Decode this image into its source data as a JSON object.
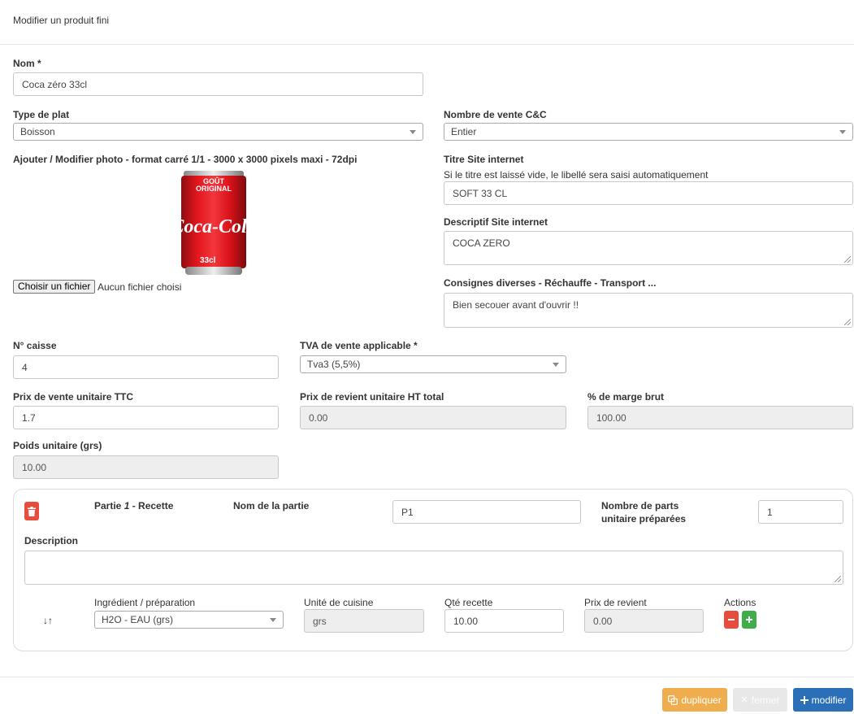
{
  "page": {
    "title": "Modifier un produit fini"
  },
  "form": {
    "nom": {
      "label": "Nom *",
      "value": "Coca zéro 33cl"
    },
    "type_plat": {
      "label": "Type de plat",
      "value": "Boisson"
    },
    "nb_vente": {
      "label": "Nombre de vente C&C",
      "value": "Entier"
    },
    "photo": {
      "label": "Ajouter / Modifier photo - format carré 1/1 - 3000 x 3000 pixels maxi - 72dpi",
      "choose_label": "Choisir un fichier",
      "no_file": "Aucun fichier choisi",
      "can_top": "GOÛT",
      "can_top2": "ORIGINAL",
      "can_brand": "Coca-Cola",
      "can_size": "33cl"
    },
    "titre_site": {
      "label": "Titre Site internet",
      "hint": "Si le titre est laissé vide, le libellé sera saisi automatiquement",
      "value": "SOFT 33 CL"
    },
    "descriptif": {
      "label": "Descriptif Site internet",
      "value": "COCA ZERO"
    },
    "consignes": {
      "label": "Consignes diverses - Réchauffe - Transport ...",
      "value": "Bien secouer avant d'ouvrir !!"
    },
    "caisse": {
      "label": "N° caisse",
      "value": "4"
    },
    "tva": {
      "label": "TVA de vente applicable *",
      "value": "Tva3 (5,5%)"
    },
    "prix_vente": {
      "label": "Prix de vente unitaire TTC",
      "value": "1.7"
    },
    "prix_revient": {
      "label": "Prix de revient unitaire HT total",
      "value": "0.00"
    },
    "marge": {
      "label": "% de marge brut",
      "value": "100.00"
    },
    "poids": {
      "label": "Poids unitaire (grs)",
      "value": "10.00"
    }
  },
  "partie": {
    "title_prefix": "Partie ",
    "number": "1",
    "title_suffix": " - Recette",
    "nom_label": "Nom de la partie",
    "nom_value": "P1",
    "parts_label_1": "Nombre de parts",
    "parts_label_2": "unitaire préparées",
    "parts_value": "1",
    "description_label": "Description",
    "description_value": "",
    "ingredient": {
      "sort_icon": "↓↑",
      "col_ingredient": "Ingrédient / préparation",
      "col_unite": "Unité de cuisine",
      "col_qte": "Qté recette",
      "col_prix": "Prix de revient",
      "col_actions": "Actions",
      "ingredient_value": "H2O - EAU (grs)",
      "unite_value": "grs",
      "qte_value": "10.00",
      "prix_value": "0.00"
    }
  },
  "footer": {
    "dupliquer": "dupliquer",
    "fermer": "fermer",
    "modifier": "modifier"
  },
  "colors": {
    "danger": "#e74c3c",
    "success": "#3fae49",
    "warning": "#f0ad4e",
    "primary": "#2a6fb8",
    "disabled": "#e8e8e8"
  }
}
